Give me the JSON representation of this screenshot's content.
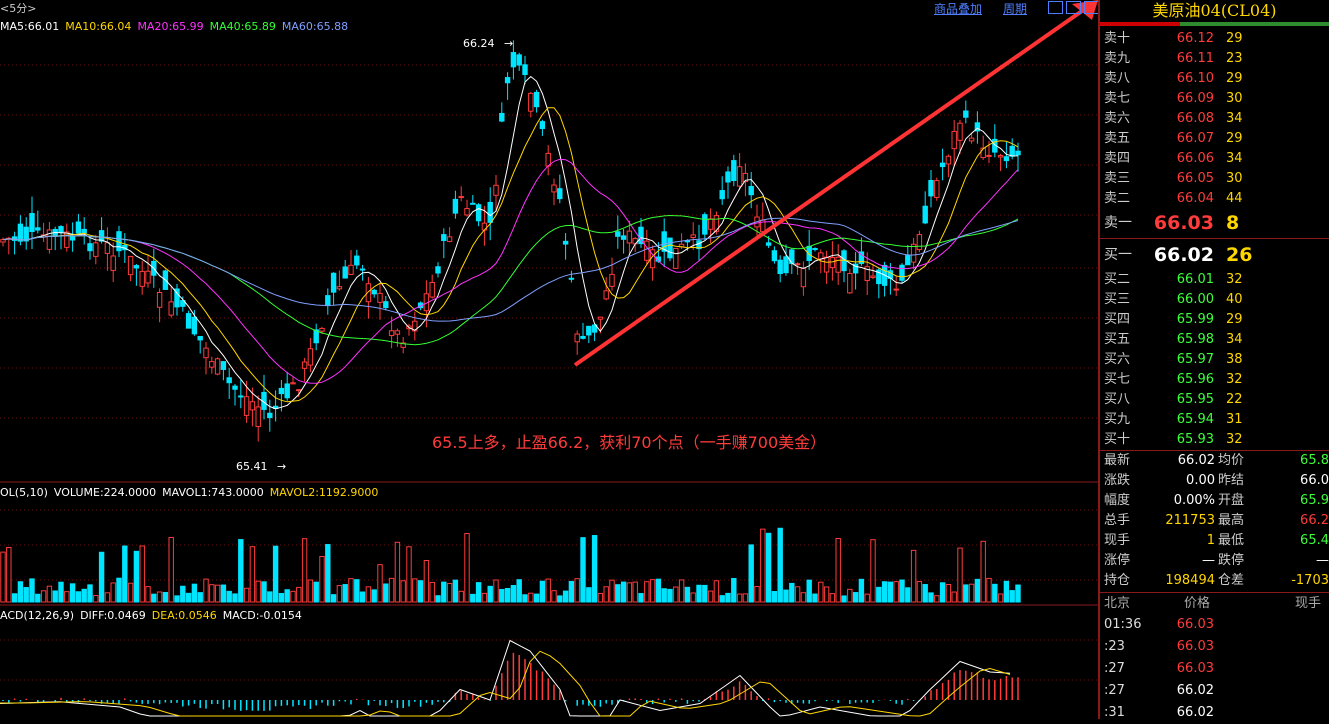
{
  "chart": {
    "period_label": "<5分>",
    "ma_legend": [
      {
        "text": "MA5:66.01",
        "color": "#ffffff"
      },
      {
        "text": "MA10:66.04",
        "color": "#ffd700"
      },
      {
        "text": "MA20:65.99",
        "color": "#ff33ff"
      },
      {
        "text": "MA40:65.89",
        "color": "#33ff33"
      },
      {
        "text": "MA60:65.88",
        "color": "#7f9fff"
      }
    ],
    "top_links": {
      "overlay": "商品叠加",
      "period": "周期"
    },
    "high_label": "66.24",
    "low_label": "65.41",
    "annotation": "65.5上多，止盈66.2，获利70个点（一手赚700美金）",
    "vol_legend": [
      {
        "text": "OL(5,10)",
        "color": "#ffffff"
      },
      {
        "text": "VOLUME:224.0000",
        "color": "#ffffff"
      },
      {
        "text": "MAVOL1:743.0000",
        "color": "#ffffff"
      },
      {
        "text": "MAVOL2:1192.9000",
        "color": "#ffd700"
      }
    ],
    "macd_legend": [
      {
        "text": "ACD(12,26,9)",
        "color": "#ffffff"
      },
      {
        "text": "DIFF:0.0469",
        "color": "#ffffff"
      },
      {
        "text": "DEA:0.0546",
        "color": "#ffd700"
      },
      {
        "text": "MACD:-0.0154",
        "color": "#ffffff"
      }
    ],
    "colors": {
      "up": "#ff3b3b",
      "down": "#00e5ff",
      "trendline": "#ff3333"
    }
  },
  "chart_data": {
    "type": "candlestick",
    "symbol_title": "美原油04(CL04)",
    "price_high": 66.24,
    "price_low": 65.41,
    "trendline": "rising line from the 65.41 area low through the right-side highs",
    "series_summary": "5-minute candles with MA5/MA10/MA20/MA40/MA60 overlays, volume and MACD sub-panels"
  },
  "panel": {
    "title": "美原油04(CL04)",
    "asks": [
      {
        "label": "卖十",
        "price": "66.12",
        "vol": "29"
      },
      {
        "label": "卖九",
        "price": "66.11",
        "vol": "23"
      },
      {
        "label": "卖八",
        "price": "66.10",
        "vol": "29"
      },
      {
        "label": "卖七",
        "price": "66.09",
        "vol": "30"
      },
      {
        "label": "卖六",
        "price": "66.08",
        "vol": "34"
      },
      {
        "label": "卖五",
        "price": "66.07",
        "vol": "29"
      },
      {
        "label": "卖四",
        "price": "66.06",
        "vol": "34"
      },
      {
        "label": "卖三",
        "price": "66.05",
        "vol": "30"
      },
      {
        "label": "卖二",
        "price": "66.04",
        "vol": "44"
      },
      {
        "label": "卖一",
        "price": "66.03",
        "vol": "8"
      }
    ],
    "bids": [
      {
        "label": "买一",
        "price": "66.02",
        "vol": "26"
      },
      {
        "label": "买二",
        "price": "66.01",
        "vol": "32"
      },
      {
        "label": "买三",
        "price": "66.00",
        "vol": "40"
      },
      {
        "label": "买四",
        "price": "65.99",
        "vol": "29"
      },
      {
        "label": "买五",
        "price": "65.98",
        "vol": "34"
      },
      {
        "label": "买六",
        "price": "65.97",
        "vol": "38"
      },
      {
        "label": "买七",
        "price": "65.96",
        "vol": "32"
      },
      {
        "label": "买八",
        "price": "65.95",
        "vol": "22"
      },
      {
        "label": "买九",
        "price": "65.94",
        "vol": "31"
      },
      {
        "label": "买十",
        "price": "65.93",
        "vol": "32"
      }
    ],
    "stats": [
      {
        "l1": "最新",
        "v1": "66.02",
        "c1": "white",
        "l2": "均价",
        "v2": "65.8",
        "c2": "green"
      },
      {
        "l1": "涨跌",
        "v1": "0.00",
        "c1": "white",
        "l2": "昨结",
        "v2": "66.0",
        "c2": "white"
      },
      {
        "l1": "幅度",
        "v1": "0.00%",
        "c1": "white",
        "l2": "开盘",
        "v2": "65.9",
        "c2": "green"
      },
      {
        "l1": "总手",
        "v1": "211753",
        "c1": "yellow",
        "l2": "最高",
        "v2": "66.2",
        "c2": "red"
      },
      {
        "l1": "现手",
        "v1": "1",
        "c1": "yellow",
        "l2": "最低",
        "v2": "65.4",
        "c2": "green"
      },
      {
        "l1": "涨停",
        "v1": "—",
        "c1": "white",
        "l2": "跌停",
        "v2": "—",
        "c2": "white"
      },
      {
        "l1": "持仓",
        "v1": "198494",
        "c1": "yellow",
        "l2": "仓差",
        "v2": "-1703",
        "c2": "yellow"
      }
    ],
    "ticks_header": {
      "time": "北京",
      "price": "价格",
      "now": "现手"
    },
    "ticks": [
      {
        "time": "01:36",
        "price": "66.03",
        "color": "red"
      },
      {
        "time": ":23",
        "price": "66.03",
        "color": "red"
      },
      {
        "time": ":27",
        "price": "66.03",
        "color": "red"
      },
      {
        "time": ":27",
        "price": "66.02",
        "color": "white"
      },
      {
        "time": ":31",
        "price": "66.02",
        "color": "white"
      }
    ]
  }
}
